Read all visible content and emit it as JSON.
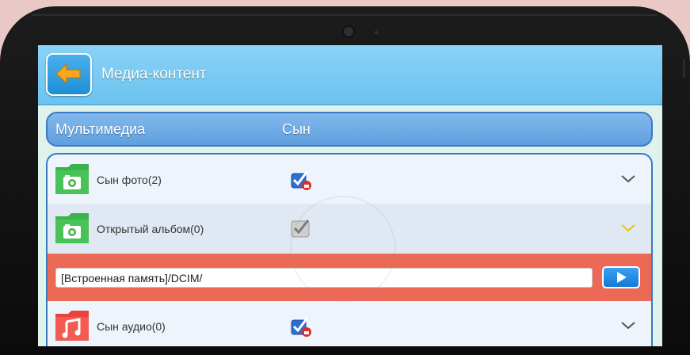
{
  "header": {
    "title": "Медиа-контент",
    "back_icon": "arrow-left-icon"
  },
  "columns": {
    "left": "Мультимедиа",
    "right": "Сын"
  },
  "items": [
    {
      "label": "Сын фото(2)",
      "icon": "photo-folder-icon",
      "checkbox": "checked-locked",
      "chevron": "chevron-down-icon"
    },
    {
      "label": "Открытый альбом(0)",
      "icon": "photo-folder-icon",
      "checkbox": "checked-disabled",
      "chevron": "chevron-down-icon"
    },
    {
      "label": "Сын аудио(0)",
      "icon": "audio-folder-icon",
      "checkbox": "checked-locked",
      "chevron": "chevron-down-icon"
    }
  ],
  "path": {
    "value": "[Встроенная память]/DCIM/",
    "button_icon": "play-icon"
  },
  "colors": {
    "topbar": "#7ccbf3",
    "header_row": "#6ea9e5",
    "path_panel": "#ec6a55",
    "photo_folder": "#3bb24a",
    "audio_folder": "#e8433c",
    "back_button": "#2a98dd",
    "expanded_chevron": "#f2c400"
  }
}
